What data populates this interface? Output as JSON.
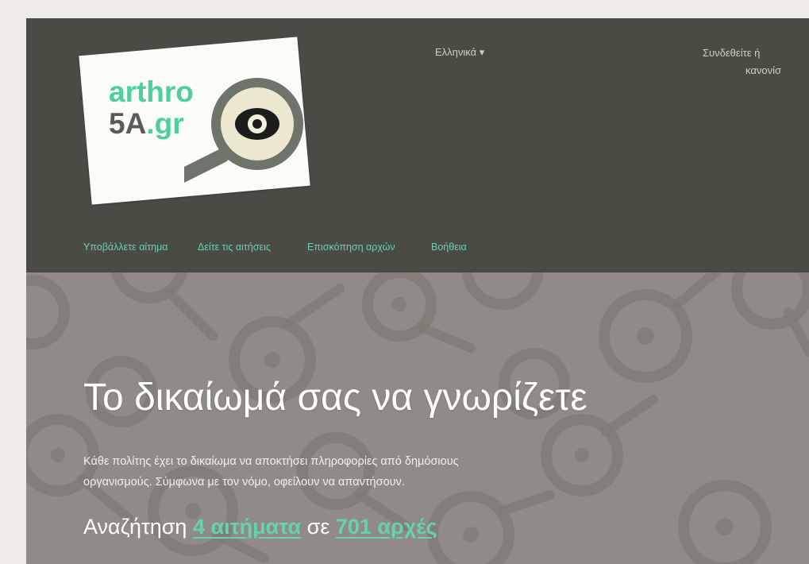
{
  "logo": {
    "line1": "arthro",
    "line2_main": "5A",
    "line2_suffix": ".gr",
    "icon": "magnifier-eye-icon"
  },
  "header": {
    "language_label": "Ελληνικά ▾",
    "login_line1": "Συνδεθείτε ή",
    "login_line2": "κανονίσ"
  },
  "nav": {
    "items": [
      {
        "label": "Υποβάλλετε αίτημα"
      },
      {
        "label": "Δείτε τις αιτήσεις"
      },
      {
        "label": "Επισκόπηση αρχών"
      },
      {
        "label": "Βοήθεια"
      }
    ]
  },
  "hero": {
    "title": "Το δικαίωμά σας να γνωρίζετε",
    "description_line1": "Κάθε πολίτης έχει το δικαίωμα να αποκτήσει πληροφορίες από δημόσιους",
    "description_line2": "οργανισμούς. Σύμφωνα με τον νόμο, οφείλουν να απαντήσουν.",
    "search_prefix": "Αναζήτηση",
    "requests_link": "4 αιτήματα",
    "search_mid": "σε",
    "authorities_link": "701 αρχές"
  },
  "colors": {
    "header_bg": "#4a4b43",
    "accent": "#67d3a8",
    "hero_bg": "#908b86"
  }
}
